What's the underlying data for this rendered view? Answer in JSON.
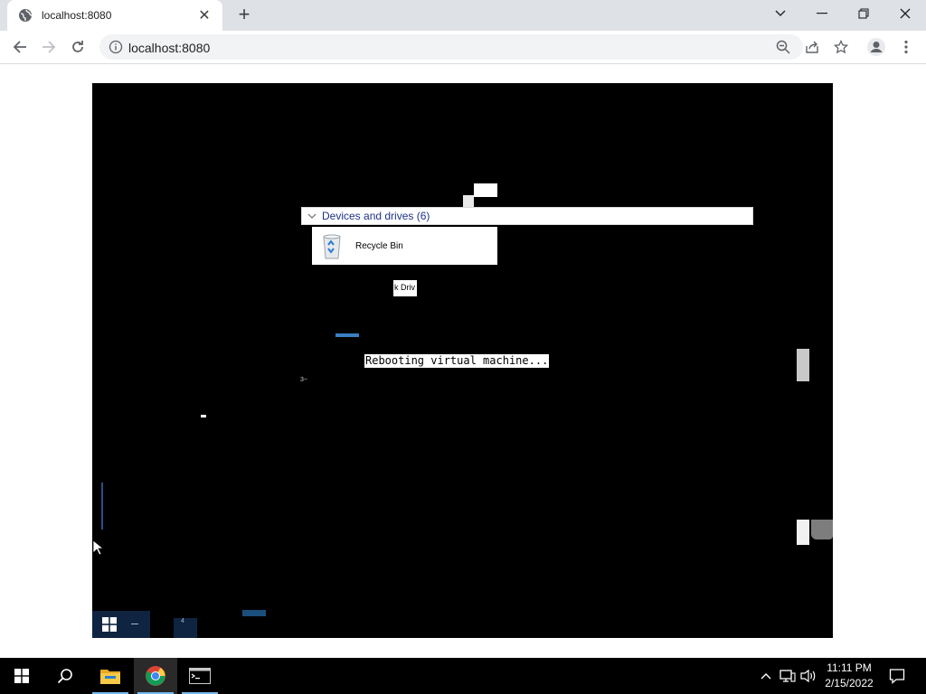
{
  "browser": {
    "tab_title": "localhost:8080",
    "url": "localhost:8080"
  },
  "vm": {
    "explorer_header": "Devices and drives (6)",
    "recycle_bin_label": "Recycle Bin",
    "drive_fragment": "k Driv",
    "status_message": "Rebooting virtual machine...",
    "tiny_text_1": "3~",
    "tiny_text_2": "4"
  },
  "taskbar": {
    "time": "11:11 PM",
    "date": "2/15/2022",
    "items": [
      "start-button",
      "search-button",
      "file-explorer",
      "chrome",
      "command-prompt"
    ]
  },
  "colors": {
    "tabstrip": "#dee1e6",
    "taskbar": "#000000",
    "vm_background": "#000000",
    "header_text": "#1e3287",
    "accent_blue": "#76b9ed"
  }
}
